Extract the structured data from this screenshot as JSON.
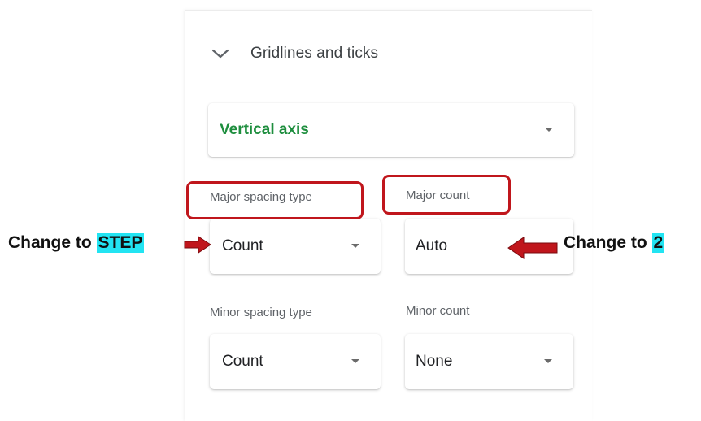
{
  "section": {
    "title": "Gridlines and ticks",
    "expand_icon": "chevron-down-icon"
  },
  "axis_select": {
    "value": "Vertical axis",
    "icon": "dropdown-arrow-icon"
  },
  "major": {
    "spacing_type_label": "Major spacing type",
    "spacing_type_value": "Count",
    "count_label": "Major count",
    "count_value": "Auto"
  },
  "minor": {
    "spacing_type_label": "Minor spacing type",
    "spacing_type_value": "Count",
    "count_label": "Minor count",
    "count_value": "None"
  },
  "annotations": {
    "left_prefix": "Change to ",
    "left_highlight": "STEP",
    "right_prefix": "Change to ",
    "right_highlight": "2"
  },
  "colors": {
    "accent_green": "#1e8e3e",
    "callout_red": "#c0161c",
    "highlight_cyan": "#22e4f2"
  }
}
